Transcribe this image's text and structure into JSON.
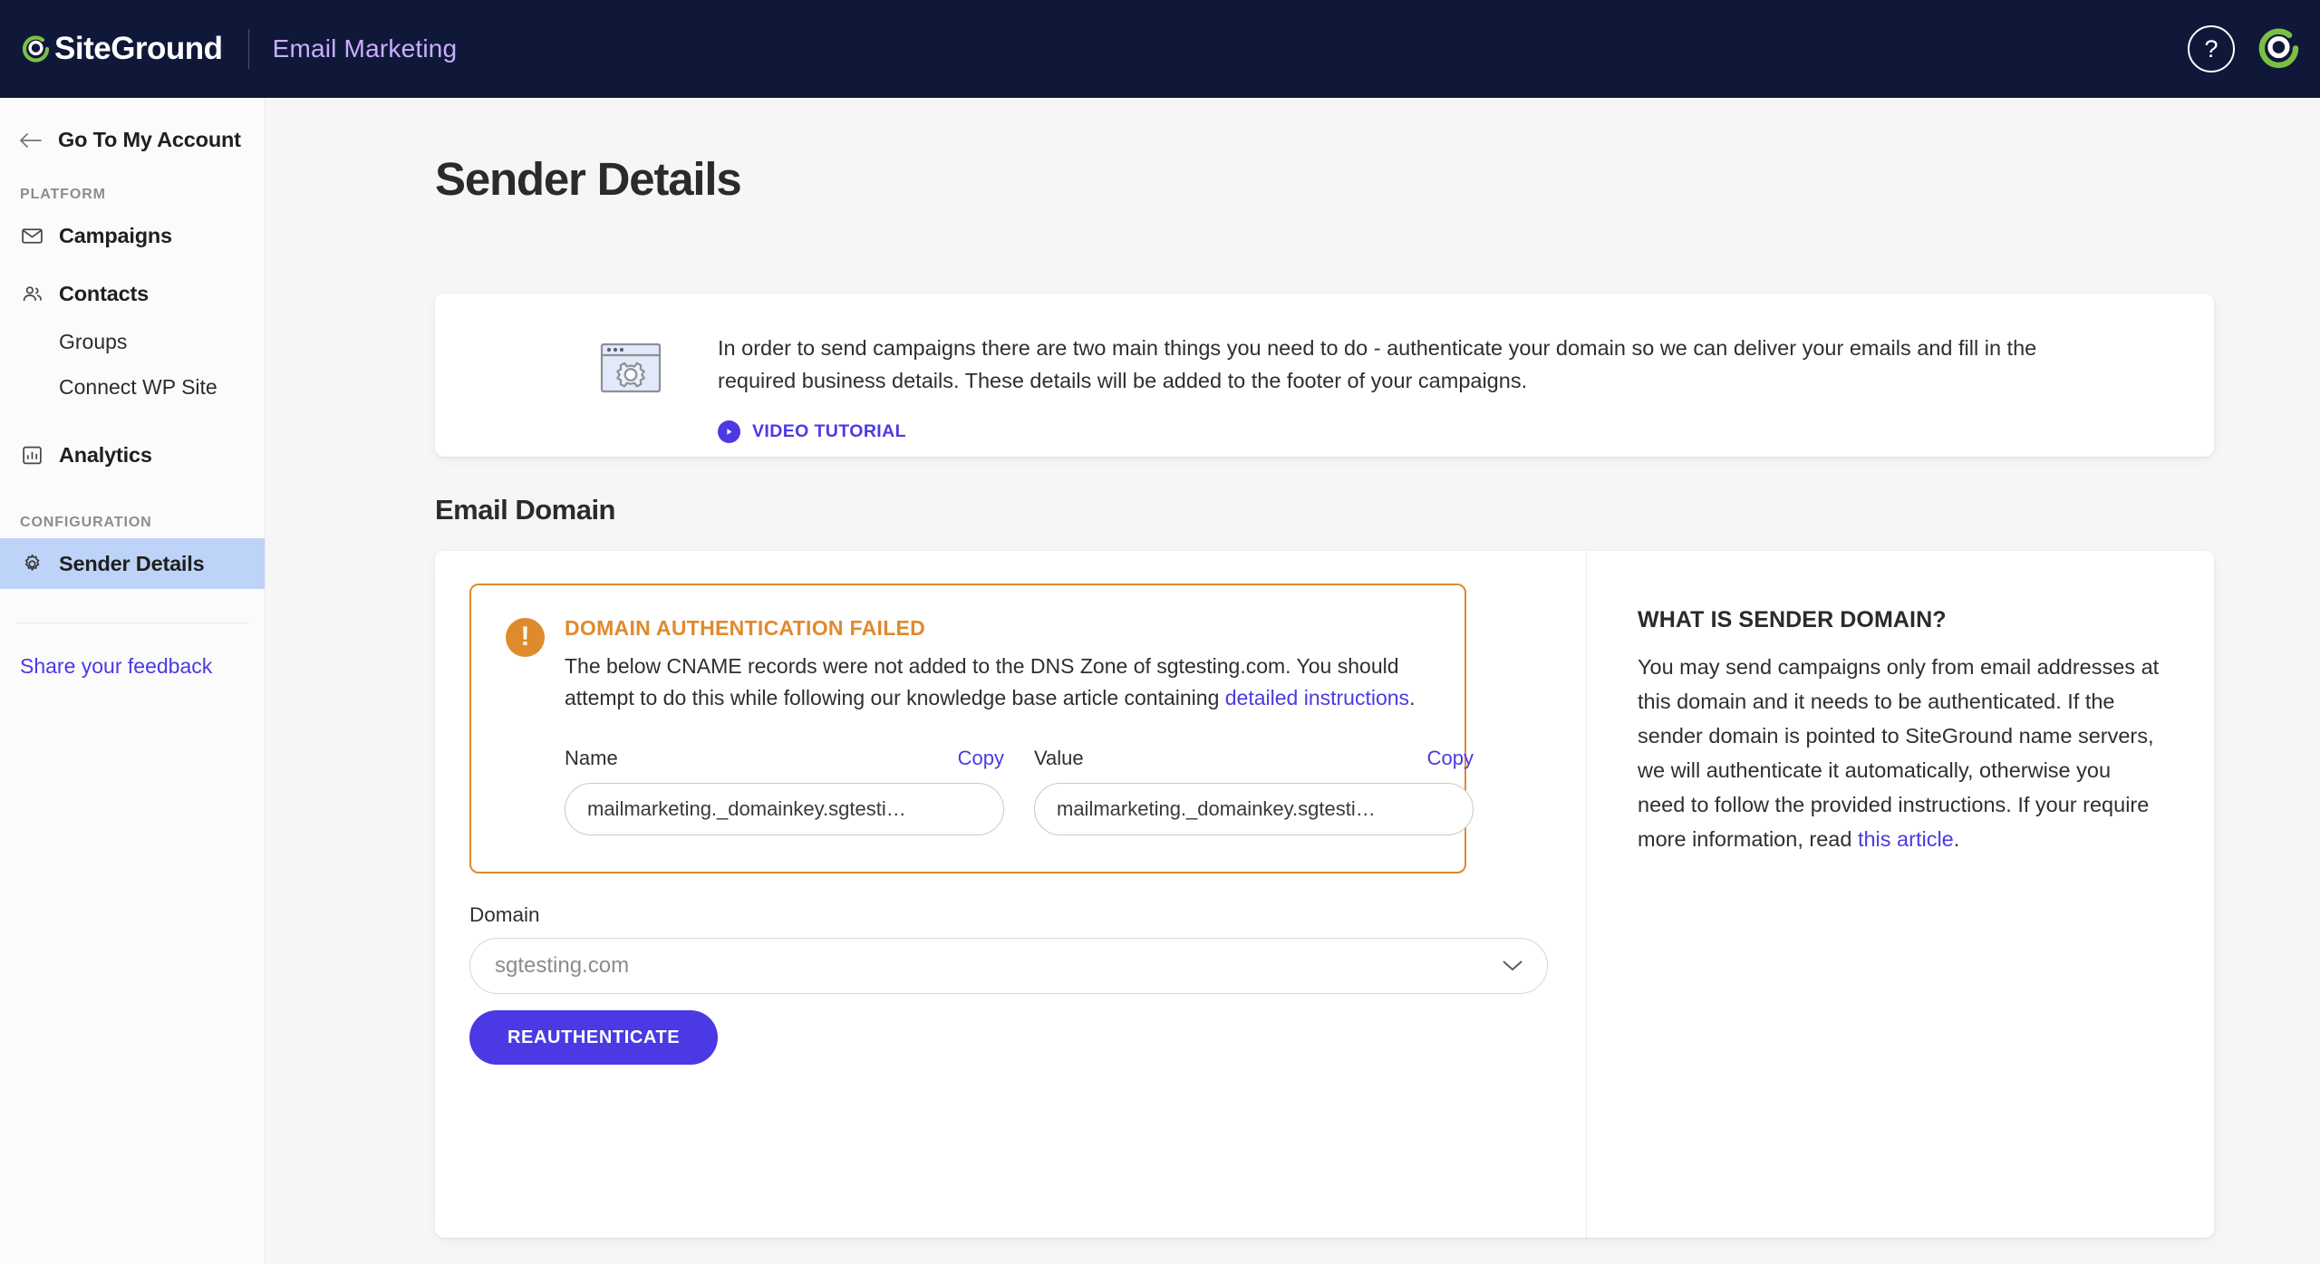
{
  "topbar": {
    "brand_name": "SiteGround",
    "app_name": "Email Marketing",
    "help_glyph": "?",
    "help_name": "help-icon",
    "avatar_name": "account-avatar"
  },
  "sidebar": {
    "back_label": "Go To My Account",
    "sections": [
      {
        "label": "PLATFORM"
      },
      {
        "label": "CONFIGURATION"
      }
    ],
    "platform_items": [
      {
        "label": "Campaigns",
        "icon": "envelope-icon",
        "active": false,
        "sub": false
      },
      {
        "label": "Contacts",
        "icon": "contacts-icon",
        "active": false,
        "sub": false
      },
      {
        "label": "Groups",
        "icon": "",
        "active": false,
        "sub": true
      },
      {
        "label": "Connect WP Site",
        "icon": "",
        "active": false,
        "sub": true
      },
      {
        "label": "Analytics",
        "icon": "analytics-icon",
        "active": false,
        "sub": false
      }
    ],
    "configuration_items": [
      {
        "label": "Sender Details",
        "icon": "gear-icon",
        "active": true,
        "sub": false
      }
    ],
    "feedback_label": "Share your feedback"
  },
  "main": {
    "page_title": "Sender Details",
    "info_card": {
      "text": "In order to send campaigns there are two main things you need to do - authenticate your domain so we can deliver your emails and fill in the required business details. These details will be added to the footer of your campaigns.",
      "video_label": "VIDEO TUTORIAL",
      "illustration_name": "browser-gear-illustration"
    },
    "section_title": "Email Domain",
    "alert": {
      "title": "DOMAIN AUTHENTICATION FAILED",
      "text_before_link": "The below CNAME records were not added to the DNS Zone of sgtesting.com. You should attempt to do this while following our knowledge base article containing ",
      "link_text": "detailed instructions",
      "text_after_link": ".",
      "icon_glyph": "!",
      "accent_color": "#e08a2e"
    },
    "records": [
      {
        "label": "Name",
        "copy_label": "Copy",
        "value": "mailmarketing._domainkey.sgtesti…"
      },
      {
        "label": "Value",
        "copy_label": "Copy",
        "value": "mailmarketing._domainkey.sgtesti…"
      }
    ],
    "domain_field": {
      "label": "Domain",
      "value": "sgtesting.com"
    },
    "reauthenticate_label": "REAUTHENTICATE",
    "aside": {
      "title": "WHAT IS SENDER DOMAIN?",
      "text_before_link": "You may send campaigns only from email addresses at this domain and it needs to be authenticated. If the sender domain is pointed to SiteGround name servers, we will authenticate it automatically, otherwise you need to follow the provided instructions. If your require more information, read ",
      "link_text": "this article",
      "text_after_link": "."
    }
  },
  "colors": {
    "topbar_bg": "#10183a",
    "accent_purple": "#4b39e4",
    "app_name_color": "#c9aefc",
    "sidebar_active_bg": "#bed3f8",
    "warning_orange": "#e08a2e",
    "logo_green": "#7ac143"
  }
}
